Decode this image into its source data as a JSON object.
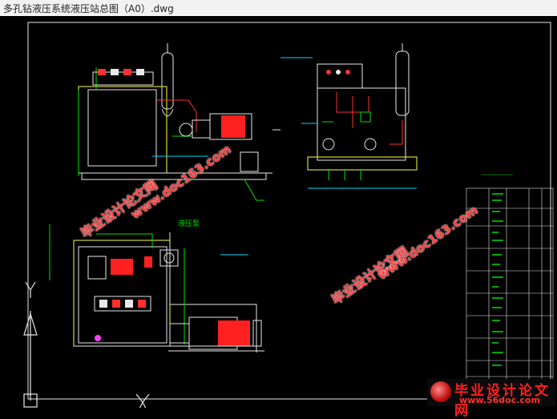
{
  "window": {
    "title": "多孔钻液压系统液压站总图（A0）.dwg"
  },
  "watermarks": {
    "site_cn": "毕业设计论文网",
    "site_url": "www.doc163.com",
    "badge_cn": "毕业设计论文网",
    "badge_url": "www.56doc.com"
  },
  "drawing": {
    "annotation_label": "液压泵",
    "colors": {
      "background": "#000000",
      "line_white": "#e8e8e8",
      "line_red": "#ff3030",
      "line_green": "#00e000",
      "line_cyan": "#00d8ff",
      "line_yellow": "#ffff40",
      "line_magenta": "#ff40ff"
    }
  }
}
